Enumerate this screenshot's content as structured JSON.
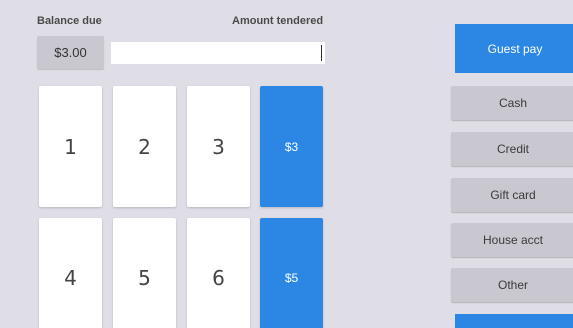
{
  "balance": {
    "label": "Balance due",
    "value": "$3.00"
  },
  "tendered": {
    "label": "Amount tendered",
    "value": ""
  },
  "keypad": {
    "keys": [
      "1",
      "2",
      "3",
      "4",
      "5",
      "6"
    ],
    "quick_amounts": [
      "$3",
      "$5"
    ]
  },
  "payment": {
    "guest_pay": "Guest pay",
    "methods": [
      "Cash",
      "Credit",
      "Gift card",
      "House acct",
      "Other"
    ]
  },
  "colors": {
    "accent": "#2b86e4",
    "background": "#dfdee6",
    "secondary_button": "#c9c8d0",
    "key": "#ffffff"
  }
}
